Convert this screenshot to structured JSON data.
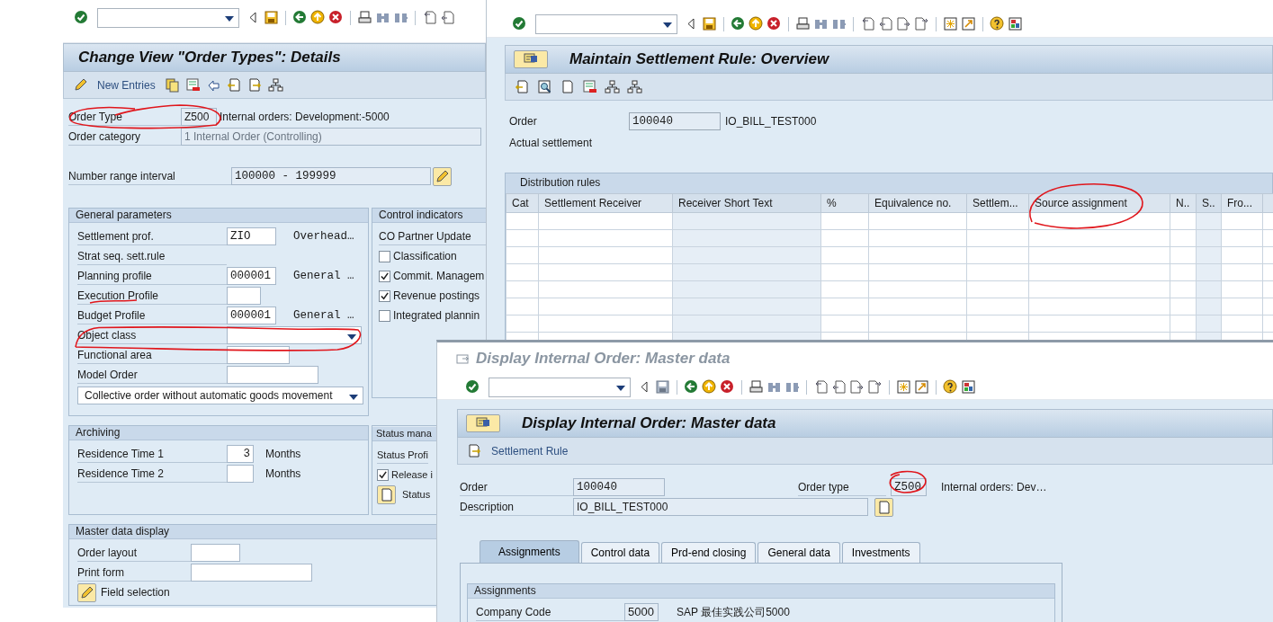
{
  "change_view_window": {
    "title": "Change View \"Order Types\": Details",
    "app_toolbar": {
      "button": "New Entries"
    },
    "header_fields": [
      {
        "label": "Order Type",
        "value": "Z500",
        "text": "Internal orders: Development:-5000",
        "disabled": false
      },
      {
        "label": "Order category",
        "value": "1 Internal Order (Controlling)",
        "disabled": true
      }
    ],
    "number_range": {
      "label": "Number range interval",
      "value": "100000 - 199999"
    },
    "general_parameters": {
      "title": "General parameters",
      "rows": [
        {
          "kind": "field",
          "label": "Settlement prof.",
          "value": "ZIO",
          "text": "Overhead…"
        },
        {
          "kind": "label",
          "label": "Strat seq. sett.rule"
        },
        {
          "kind": "field",
          "label": "Planning profile",
          "value": "000001",
          "text": "General …"
        },
        {
          "kind": "field",
          "label": "Execution Profile"
        },
        {
          "kind": "field",
          "label": "Budget Profile",
          "value": "000001",
          "text": "General …"
        },
        {
          "kind": "dropdown",
          "label": "Object class"
        },
        {
          "kind": "field",
          "label": "Functional area"
        },
        {
          "kind": "field",
          "label": "Model Order"
        }
      ],
      "selector": "Collective order without automatic goods movement"
    },
    "control_indicators": {
      "title": "Control indicators",
      "items": [
        {
          "kind": "label",
          "label": "CO Partner Update"
        },
        {
          "kind": "checkbox",
          "label": "Classification",
          "checked": false
        },
        {
          "kind": "checkbox",
          "label": "Commit. Managem",
          "checked": true
        },
        {
          "kind": "checkbox",
          "label": "Revenue postings",
          "checked": true
        },
        {
          "kind": "checkbox",
          "label": "Integrated plannin",
          "checked": false
        }
      ]
    },
    "archiving": {
      "title": "Archiving",
      "rows": [
        {
          "label": "Residence Time 1",
          "value": "3",
          "unit": "Months"
        },
        {
          "label": "Residence Time 2",
          "unit": "Months"
        }
      ]
    },
    "status_management": {
      "title": "Status mana",
      "label": "Status Profi",
      "checkbox": {
        "label": "Release i",
        "checked": true
      },
      "button": "Status"
    },
    "master_data_display": {
      "title": "Master data display",
      "rows": [
        {
          "label": "Order layout"
        },
        {
          "label": "Print form"
        }
      ],
      "button": "Field selection"
    }
  },
  "settlement_window": {
    "title": "Maintain Settlement Rule: Overview",
    "order": {
      "label": "Order",
      "value": "100040",
      "text": "IO_BILL_TEST000"
    },
    "section_label": "Actual settlement",
    "table": {
      "title": "Distribution rules",
      "columns": [
        {
          "label": "Cat",
          "shaded": false
        },
        {
          "label": "Settlement Receiver",
          "shaded": false
        },
        {
          "label": "Receiver Short Text",
          "shaded": true
        },
        {
          "label": "%",
          "shaded": false
        },
        {
          "label": "Equivalence no.",
          "shaded": false
        },
        {
          "label": "Settlem...",
          "shaded": false
        },
        {
          "label": "Source assignment",
          "shaded": false
        },
        {
          "label": "N..",
          "shaded": false
        },
        {
          "label": "S..",
          "shaded": true
        },
        {
          "label": "Fro...",
          "shaded": false
        }
      ]
    }
  },
  "master_data_window": {
    "window_title": "Display Internal Order: Master data",
    "title": "Display Internal Order: Master data",
    "app_toolbar": {
      "button": "Settlement Rule"
    },
    "order": {
      "label": "Order",
      "value": "100040"
    },
    "order_type": {
      "label": "Order type",
      "value": "Z500",
      "text": "Internal orders: Dev…"
    },
    "description": {
      "label": "Description",
      "value": "IO_BILL_TEST000"
    },
    "tabs": [
      {
        "label": "Assignments",
        "selected": true
      },
      {
        "label": "Control data",
        "selected": false
      },
      {
        "label": "Prd-end closing",
        "selected": false
      },
      {
        "label": "General data",
        "selected": false
      },
      {
        "label": "Investments",
        "selected": false
      }
    ],
    "assignments": {
      "title": "Assignments",
      "rows": [
        {
          "label": "Company Code",
          "value": "5000",
          "text": "SAP 最佳实践公司5000"
        }
      ]
    }
  }
}
